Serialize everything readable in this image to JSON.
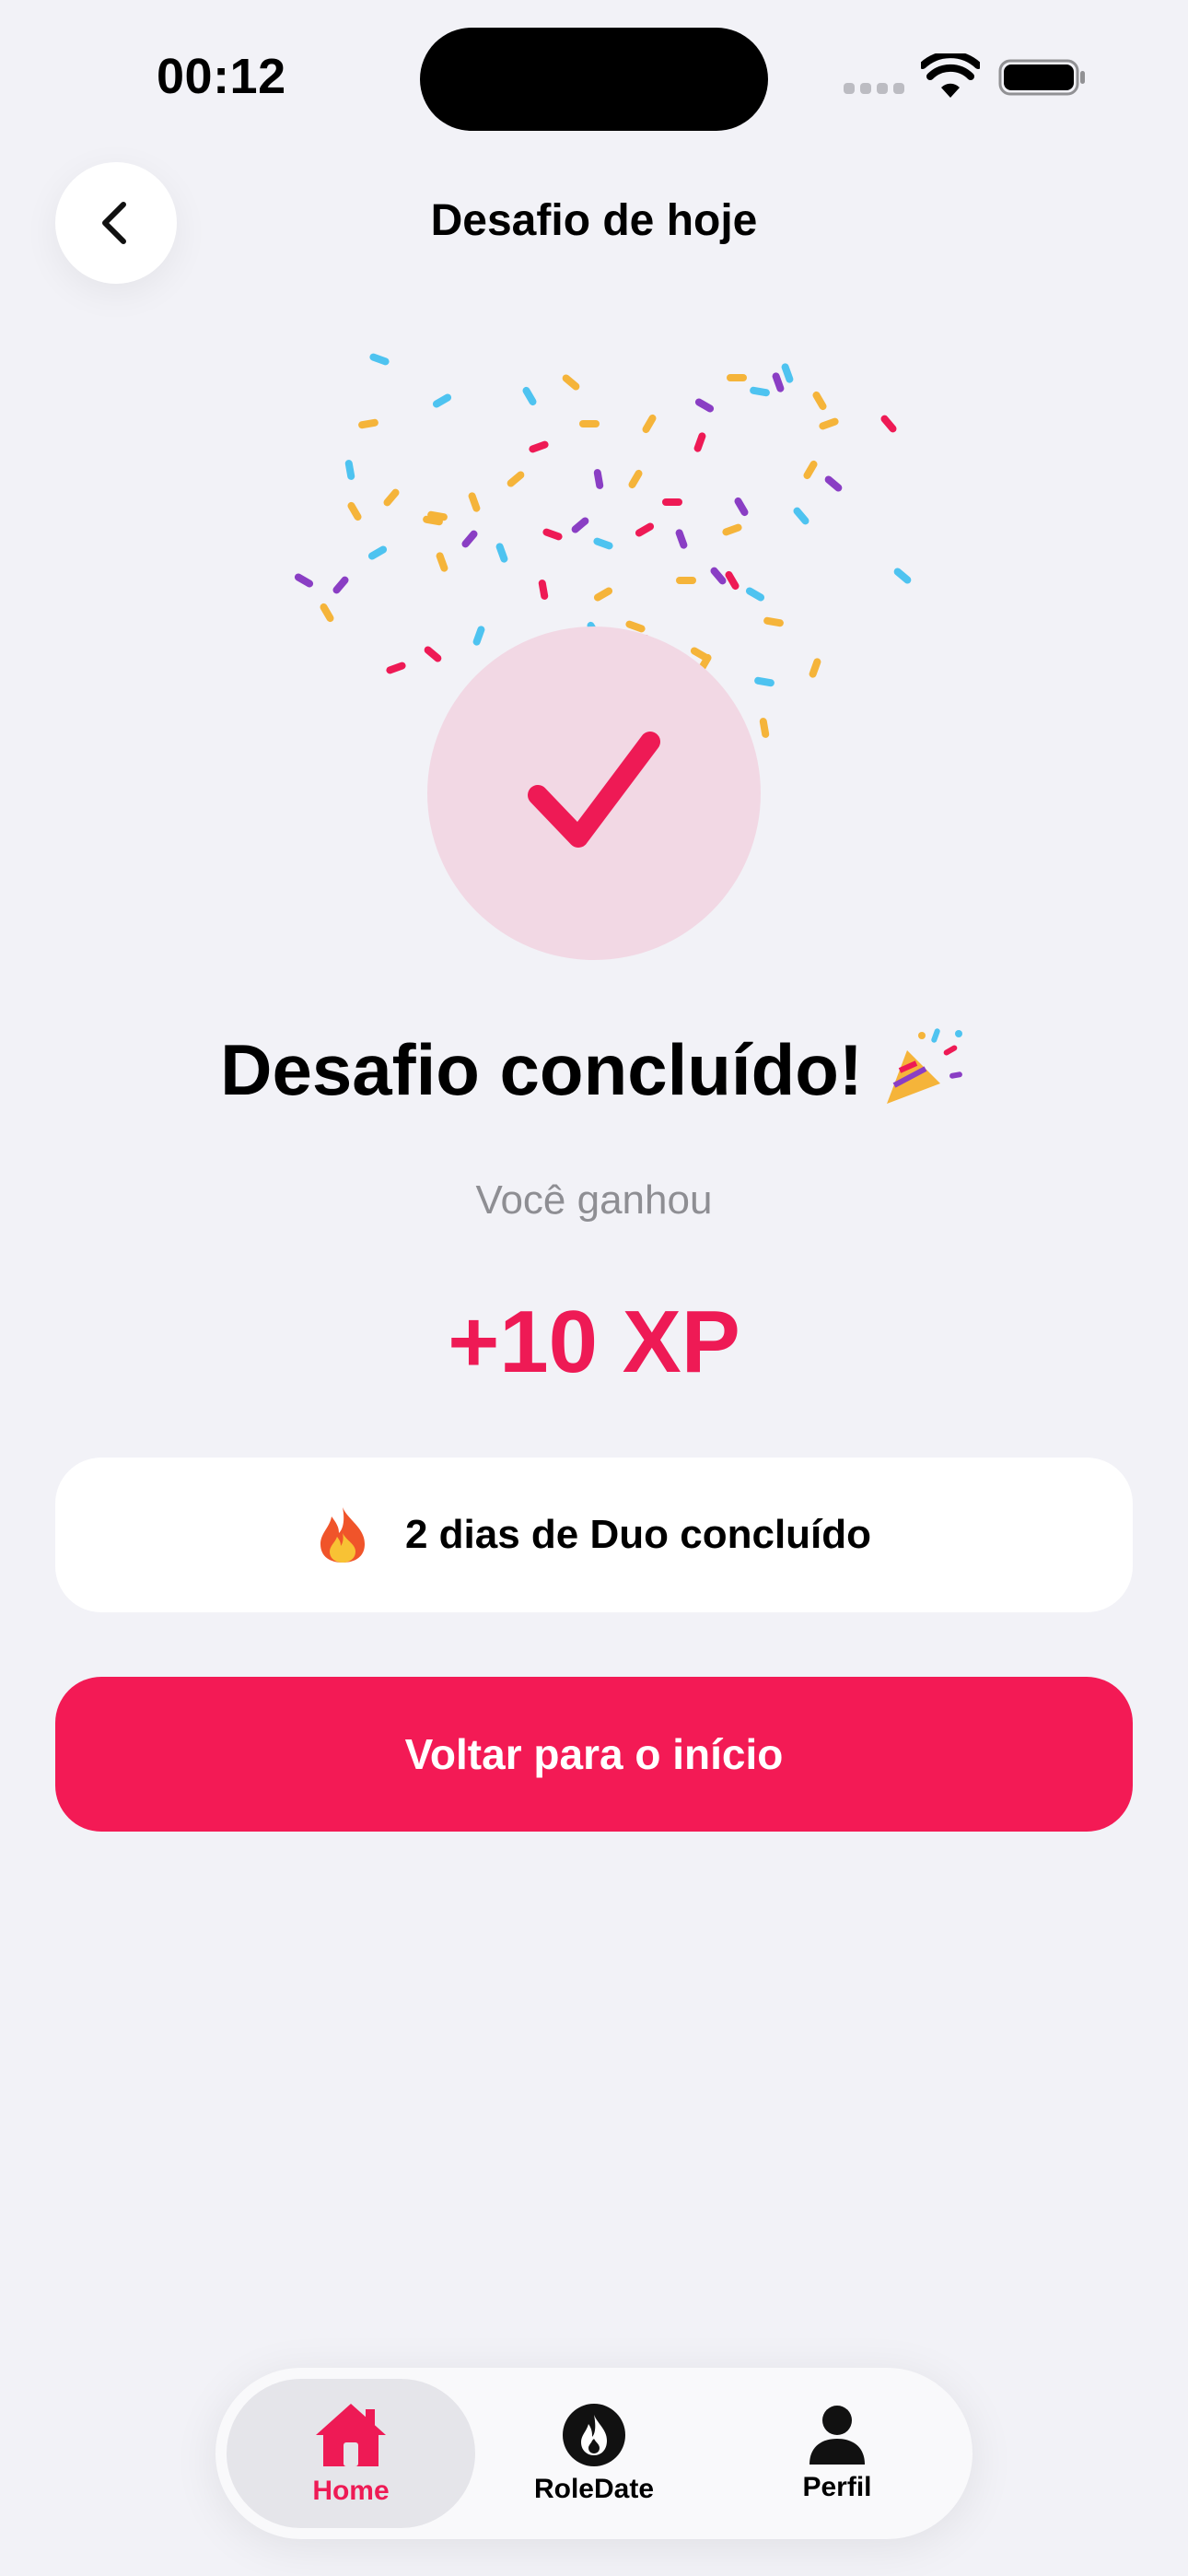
{
  "status_bar": {
    "time": "00:12"
  },
  "header": {
    "title": "Desafio de hoje",
    "back_icon": "chevron-left-icon"
  },
  "result": {
    "icon": "checkmark-icon",
    "headline": "Desafio concluído!",
    "headline_emoji": "party-popper-icon",
    "subtitle": "Você ganhou",
    "xp": "+10 XP"
  },
  "streak": {
    "icon": "fire-icon",
    "text": "2 dias de Duo concluído"
  },
  "cta": {
    "label": "Voltar para o início"
  },
  "tabbar": {
    "items": [
      {
        "label": "Home",
        "icon": "home-icon",
        "active": true
      },
      {
        "label": "RoleDate",
        "icon": "flame-badge-icon",
        "active": false
      },
      {
        "label": "Perfil",
        "icon": "person-icon",
        "active": false
      }
    ]
  },
  "colors": {
    "accent": "#F31A55",
    "background": "#F2F2F7",
    "check_bg": "#F2D8E4"
  }
}
